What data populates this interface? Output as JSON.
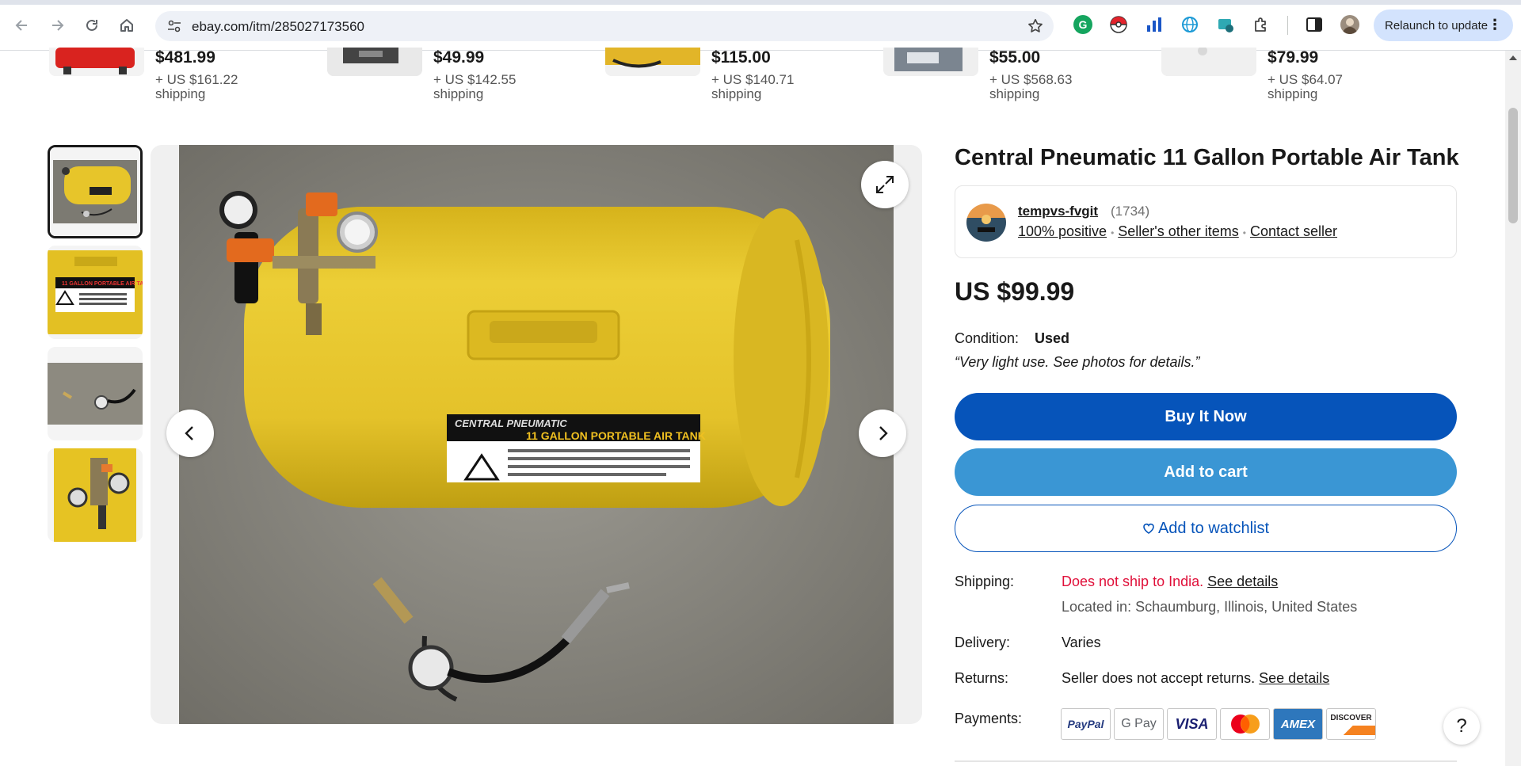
{
  "browser": {
    "url": "ebay.com/itm/285027173560",
    "relaunch_label": "Relaunch to update"
  },
  "similar_items": [
    {
      "price": "$481.99",
      "shipping": "+ US $161.22 shipping"
    },
    {
      "price": "$49.99",
      "shipping": "+ US $142.55 shipping"
    },
    {
      "price": "$115.00",
      "shipping": "+ US $140.71 shipping"
    },
    {
      "price": "$55.00",
      "shipping": "+ US $568.63 shipping"
    },
    {
      "price": "$79.99",
      "shipping": "+ US $64.07 shipping"
    }
  ],
  "listing": {
    "title": "Central Pneumatic 11 Gallon Portable Air Tank",
    "photo_label_line1": "CENTRAL PNEUMATIC",
    "photo_label_line2": "11 GALLON PORTABLE AIR TANK"
  },
  "seller": {
    "name": "tempvs-fvgit",
    "feedback_count": "(1734)",
    "positive": "100% positive",
    "other_items": "Seller's other items",
    "contact": "Contact seller"
  },
  "price": "US $99.99",
  "condition": {
    "label": "Condition:",
    "value": "Used",
    "note": "“Very light use. See photos for details.”"
  },
  "buttons": {
    "buy": "Buy It Now",
    "cart": "Add to cart",
    "watch": "Add to watchlist"
  },
  "shipping": {
    "label": "Shipping:",
    "warning": "Does not ship to India",
    "period": ".",
    "details_link": "See details",
    "location": "Located in: Schaumburg, Illinois, United States"
  },
  "delivery": {
    "label": "Delivery:",
    "value": "Varies"
  },
  "returns": {
    "label": "Returns:",
    "value": "Seller does not accept returns.",
    "details_link": "See details"
  },
  "payments": {
    "label": "Payments:",
    "methods": [
      "PayPal",
      "G Pay",
      "VISA",
      "Mastercard",
      "AMEX",
      "DISCOVER"
    ]
  },
  "help": "?",
  "colors": {
    "accent": "#0654ba",
    "cart": "#3a96d4",
    "warning": "#e0103a",
    "tank_yellow": "#e7c52a"
  }
}
